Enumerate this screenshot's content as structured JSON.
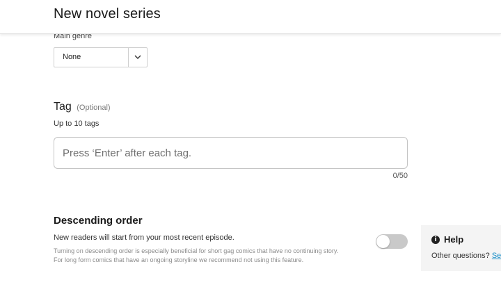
{
  "header": {
    "title": "New novel series"
  },
  "main_genre": {
    "label": "Main genre",
    "selected": "None"
  },
  "tag": {
    "heading": "Tag",
    "optional": "(Optional)",
    "subtitle": "Up to 10 tags",
    "placeholder": "Press ‘Enter’ after each tag.",
    "counter": "0/50"
  },
  "descending_order": {
    "heading": "Descending order",
    "subtitle": "New readers will start from your most recent episode.",
    "note_line1": "Turning on descending order is especially beneficial for short gag comics that have no continuing story.",
    "note_line2": "For long form comics that have an ongoing storyline we recommend not using this feature.",
    "toggle_on": false
  },
  "help": {
    "title": "Help",
    "text": "Other questions?",
    "link": "Se"
  }
}
